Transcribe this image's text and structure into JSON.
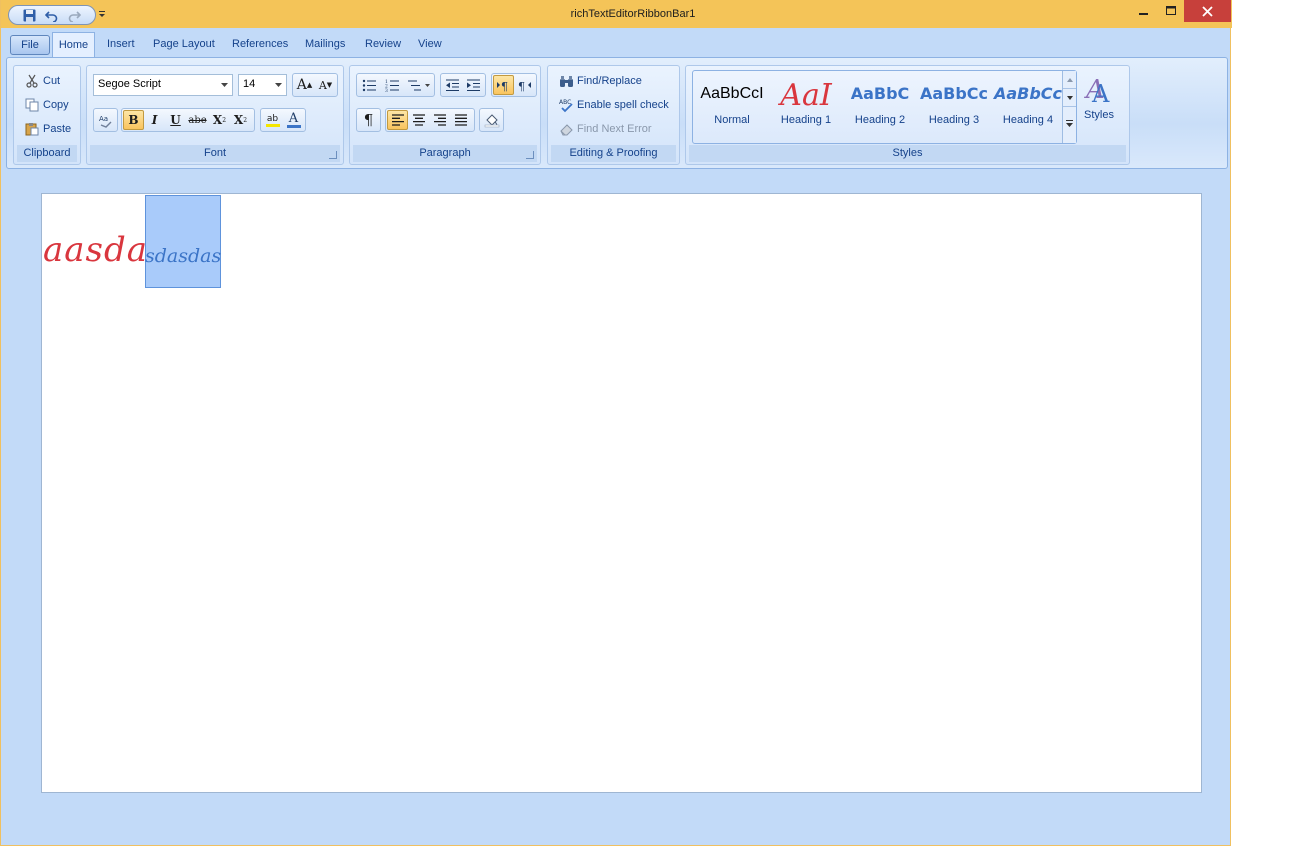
{
  "window": {
    "title": "richTextEditorRibbonBar1",
    "title_bar_color": "#f4c458",
    "close_color": "#c7403b"
  },
  "quick_access": {
    "save_icon": "save-icon",
    "undo_icon": "undo-icon",
    "redo_icon": "redo-icon",
    "customize_icon": "dropdown-icon"
  },
  "tabs": {
    "file": "File",
    "home": "Home",
    "insert": "Insert",
    "page_layout": "Page Layout",
    "references": "References",
    "mailings": "Mailings",
    "review": "Review",
    "view": "View",
    "active": "Home"
  },
  "clipboard": {
    "label": "Clipboard",
    "cut": "Cut",
    "copy": "Copy",
    "paste": "Paste"
  },
  "font": {
    "label": "Font",
    "family": "Segoe Script",
    "size": "14",
    "grow_label": "A",
    "shrink_label": "A",
    "bold_label": "B",
    "italic_label": "I",
    "underline_label": "U",
    "strike_label": "abe",
    "subscript_label": "X",
    "superscript_label": "X",
    "highlight_label": "ab",
    "color_label": "A"
  },
  "paragraph": {
    "label": "Paragraph",
    "pilcrow_label": "¶",
    "rtl_label": "¶"
  },
  "editing": {
    "label": "Editing & Proofing",
    "find_replace": "Find/Replace",
    "spell_check": "Enable spell check",
    "find_next_error": "Find Next Error"
  },
  "styles": {
    "label": "Styles",
    "button_label": "Styles",
    "items": [
      {
        "preview": "AaBbCcI",
        "name": "Normal",
        "color": "#000000"
      },
      {
        "preview": "AaI",
        "name": "Heading 1",
        "color": "#d9363e"
      },
      {
        "preview": "AaBbC",
        "name": "Heading 2",
        "color": "#3b74c7"
      },
      {
        "preview": "AaBbCc",
        "name": "Heading 3",
        "color": "#3b74c7"
      },
      {
        "preview": "AaBbCc",
        "name": "Heading 4",
        "color": "#3b74c7"
      }
    ]
  },
  "document": {
    "text_normal": "aasda",
    "text_selected": "sdasdas",
    "text_normal_color": "#d9363e",
    "text_selected_color": "#3b74c7",
    "selection_color": "#a9cbfa"
  }
}
